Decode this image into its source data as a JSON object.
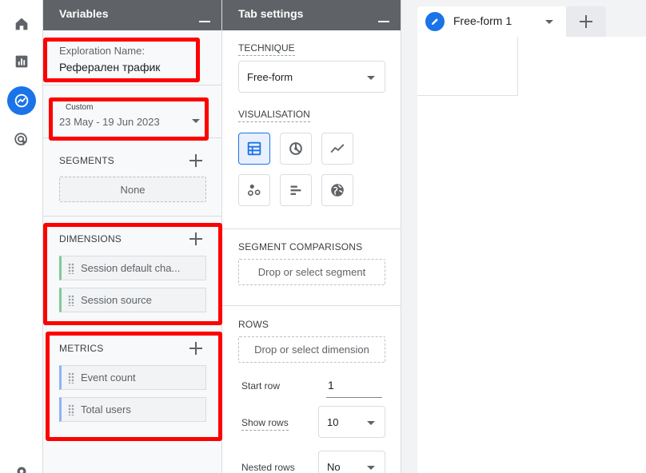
{
  "variables_panel": {
    "title": "Variables",
    "exploration_name": {
      "label": "Exploration Name:",
      "value": "Реферален трафик"
    },
    "date_range": {
      "preset": "Custom",
      "value": "23 May - 19 Jun 2023"
    },
    "segments": {
      "title": "SEGMENTS",
      "empty_text": "None"
    },
    "dimensions": {
      "title": "DIMENSIONS",
      "items": [
        "Session default cha...",
        "Session source"
      ]
    },
    "metrics": {
      "title": "METRICS",
      "items": [
        "Event count",
        "Total users"
      ]
    }
  },
  "tab_settings_panel": {
    "title": "Tab settings",
    "technique": {
      "label": "TECHNIQUE",
      "value": "Free-form"
    },
    "visualisation": {
      "label": "VISUALISATION"
    },
    "segment_comparisons": {
      "label": "SEGMENT COMPARISONS",
      "placeholder": "Drop or select segment"
    },
    "rows": {
      "label": "ROWS",
      "placeholder": "Drop or select dimension",
      "start_row_label": "Start row",
      "start_row_value": "1",
      "show_rows_label": "Show rows",
      "show_rows_value": "10",
      "nested_rows_label": "Nested rows",
      "nested_rows_value": "No"
    }
  },
  "canvas": {
    "tab_name": "Free-form 1"
  },
  "colors": {
    "accent": "#1a73e8",
    "highlight_box": "#ff0000",
    "dimension_chip": "#81c995",
    "metric_chip": "#8ab4f8",
    "panel_header": "#5f6368"
  },
  "icons": {
    "rail": [
      "home-icon",
      "reports-icon",
      "explore-icon",
      "advertising-icon",
      "settings-icon"
    ],
    "visualisation": [
      "table-icon",
      "donut-chart-icon",
      "line-chart-icon",
      "scatter-plot-icon",
      "bar-chart-icon",
      "geo-map-icon"
    ]
  }
}
